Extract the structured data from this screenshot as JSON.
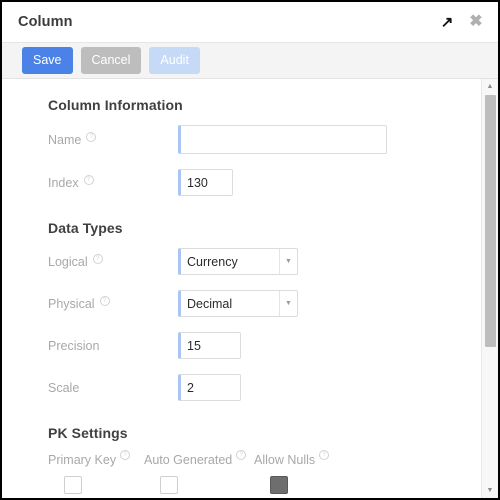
{
  "header": {
    "title": "Column",
    "expand_icon": "expand-arrow-icon",
    "expand_glyph": "↗",
    "close_icon": "close-icon",
    "close_glyph": "✖"
  },
  "toolbar": {
    "save_label": "Save",
    "cancel_label": "Cancel",
    "audit_label": "Audit"
  },
  "sections": {
    "column_information": {
      "title": "Column Information",
      "name": {
        "label": "Name",
        "value": "",
        "placeholder": ""
      },
      "index": {
        "label": "Index",
        "value": "130"
      }
    },
    "data_types": {
      "title": "Data Types",
      "logical": {
        "label": "Logical",
        "value": "Currency"
      },
      "physical": {
        "label": "Physical",
        "value": "Decimal"
      },
      "precision": {
        "label": "Precision",
        "value": "15"
      },
      "scale": {
        "label": "Scale",
        "value": "2"
      }
    },
    "pk_settings": {
      "title": "PK Settings",
      "primary_key": {
        "label": "Primary Key",
        "checked": "false"
      },
      "auto_generated": {
        "label": "Auto Generated",
        "checked": "false"
      },
      "allow_nulls": {
        "label": "Allow Nulls",
        "checked": "true"
      }
    }
  },
  "scrollbar": {
    "up_glyph": "▲",
    "down_glyph": "▼"
  },
  "colors": {
    "primary": "#4a82e8",
    "secondary": "#bdbdbd",
    "disabled": "#c6d9f7",
    "input_accent": "#a9c4f5",
    "toolbar_bg": "#f4f4f4"
  }
}
